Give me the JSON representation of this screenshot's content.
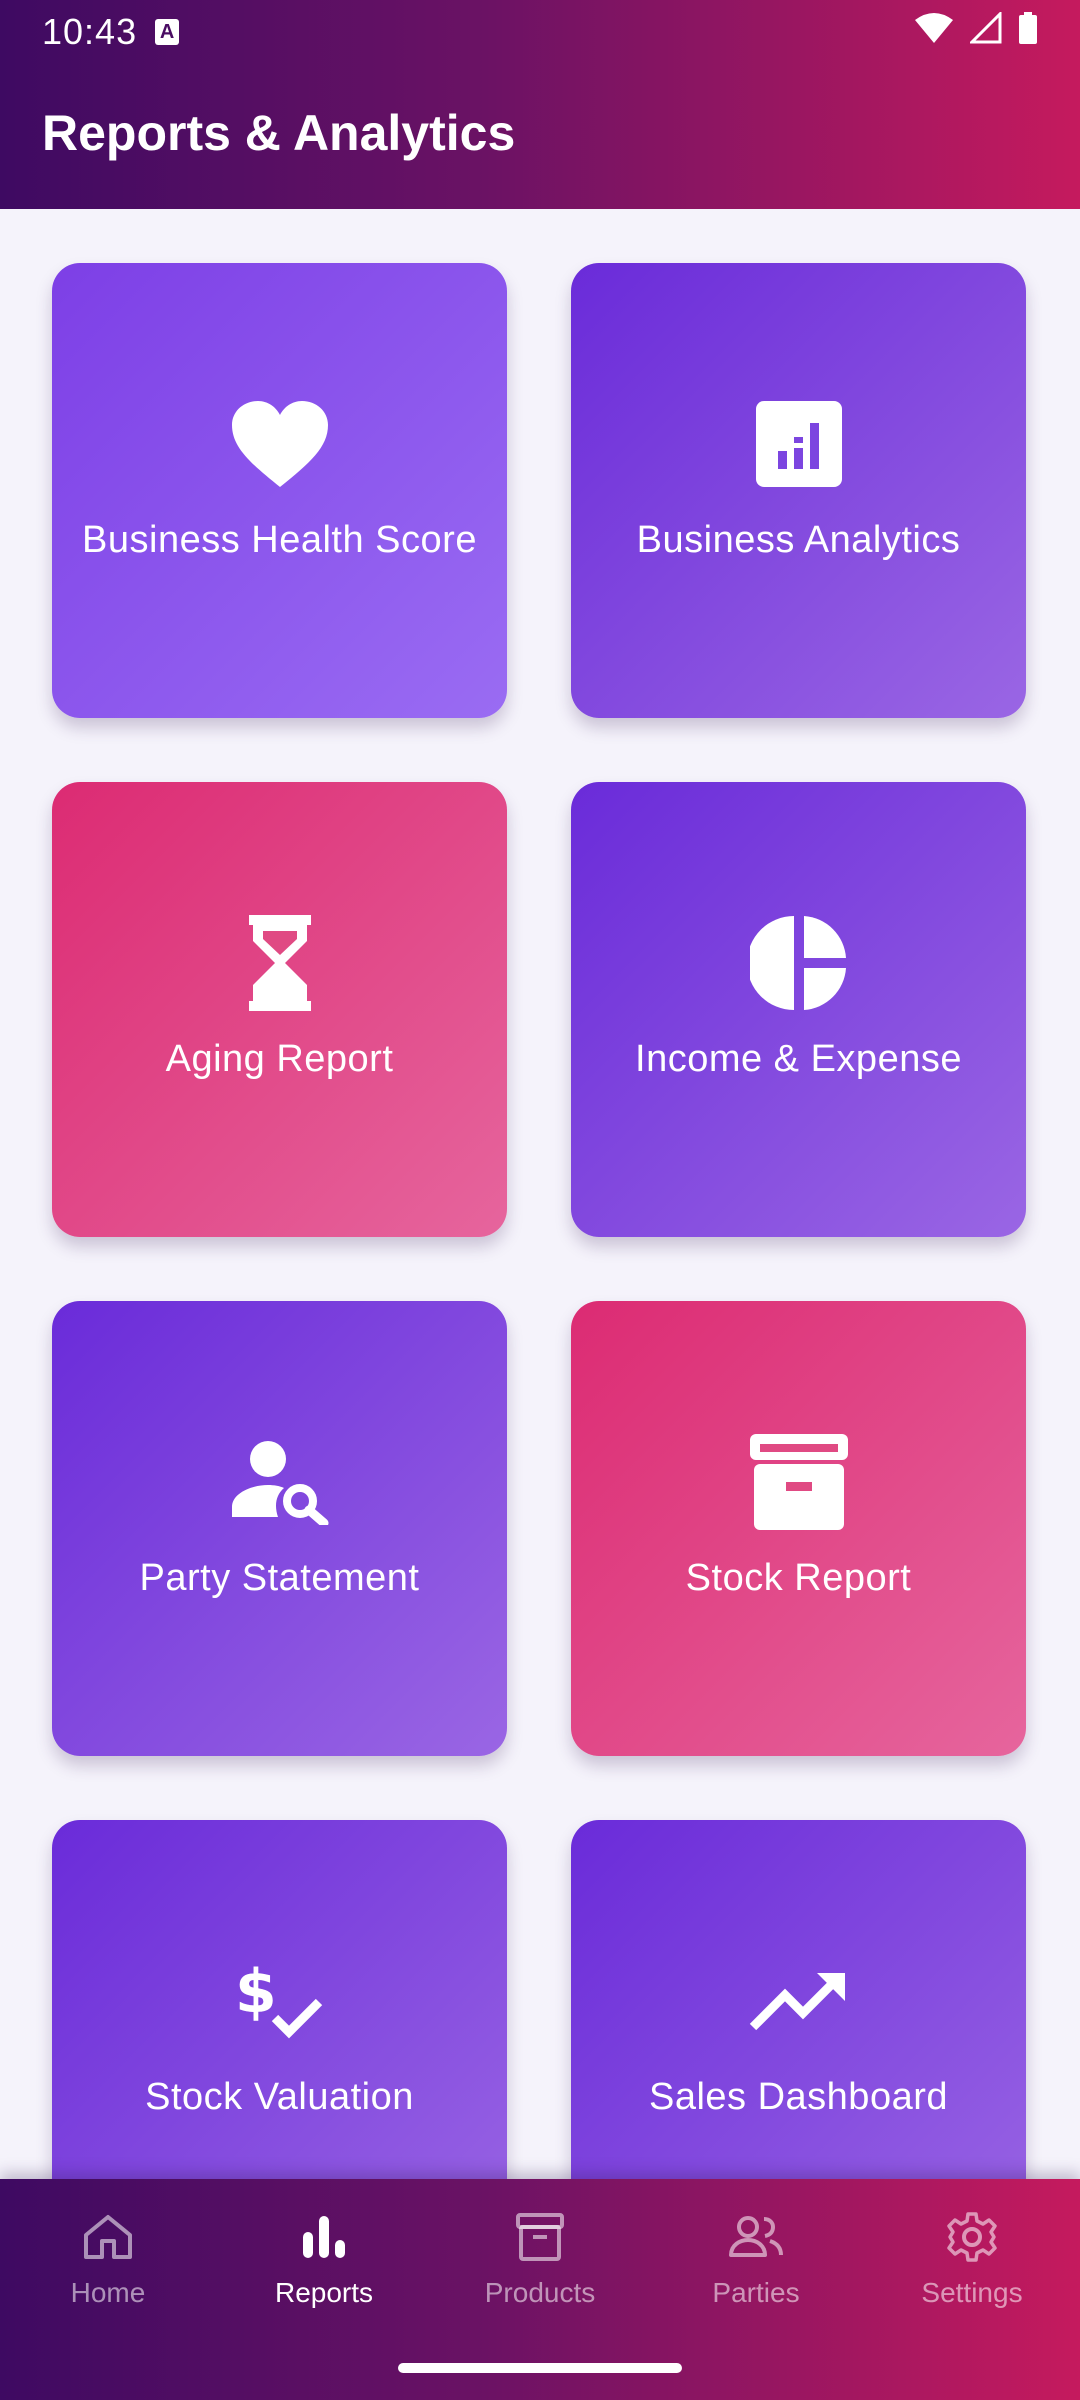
{
  "status_bar": {
    "time": "10:43",
    "badge": "A"
  },
  "header": {
    "title": "Reports & Analytics"
  },
  "cards": [
    {
      "label": "Business Health Score",
      "icon": "heart-icon"
    },
    {
      "label": "Business Analytics",
      "icon": "analytics-icon"
    },
    {
      "label": "Aging Report",
      "icon": "hourglass-icon"
    },
    {
      "label": "Income & Expense",
      "icon": "pie-chart-icon"
    },
    {
      "label": "Party Statement",
      "icon": "person-search-icon"
    },
    {
      "label": "Stock Report",
      "icon": "archive-box-icon"
    },
    {
      "label": "Stock Valuation",
      "icon": "dollar-check-icon"
    },
    {
      "label": "Sales Dashboard",
      "icon": "trending-up-icon"
    }
  ],
  "nav": {
    "items": [
      {
        "label": "Home",
        "icon": "home-icon"
      },
      {
        "label": "Reports",
        "icon": "bar-chart-icon"
      },
      {
        "label": "Products",
        "icon": "archive-icon"
      },
      {
        "label": "Parties",
        "icon": "people-icon"
      },
      {
        "label": "Settings",
        "icon": "gear-icon"
      }
    ],
    "active": "Reports"
  },
  "colors": {
    "header_gradient": [
      "#3e0a62",
      "#6b1264",
      "#c51a5e"
    ],
    "card_purple": "#7d3fe6",
    "card_pink": "#dc2b73",
    "background": "#f5f3fb"
  }
}
